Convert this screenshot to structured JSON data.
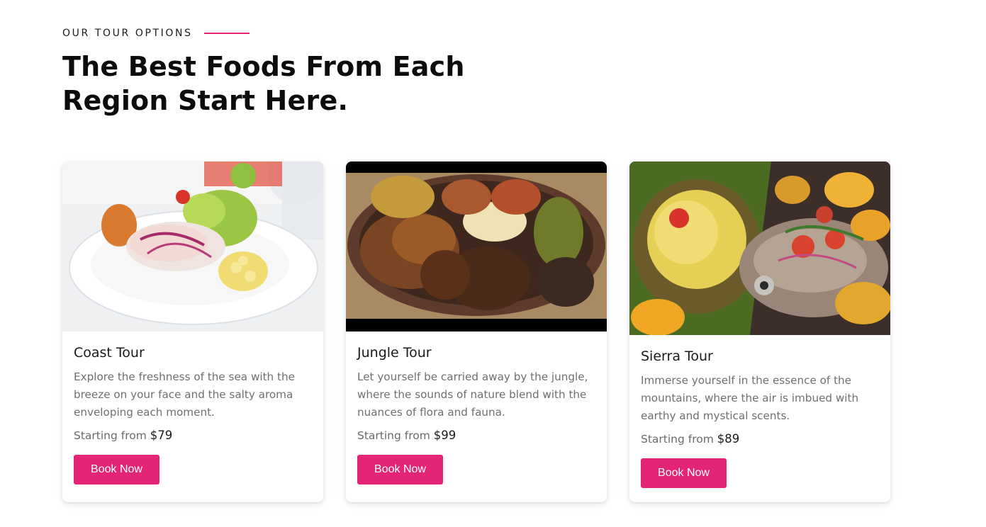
{
  "section": {
    "eyebrow": "OUR TOUR OPTIONS",
    "headline_line1": "The Best Foods From Each",
    "headline_line2": "Region Start Here.",
    "accent_color": "#e0246f"
  },
  "tours": [
    {
      "title": "Coast Tour",
      "description": "Explore the freshness of the sea with the breeze on your face and the salty aroma enveloping each moment.",
      "price_label": "Starting from",
      "price": "$79",
      "button_label": "Book Now",
      "image": "ceviche-plate-photo"
    },
    {
      "title": "Jungle Tour",
      "description": "Let yourself be carried away by the jungle, where the sounds of nature blend with the nuances of flora and fauna.",
      "price_label": "Starting from",
      "price": "$99",
      "button_label": "Book Now",
      "image": "grilled-meats-bowl-photo"
    },
    {
      "title": "Sierra Tour",
      "description": "Immerse yourself in the essence of the mountains, where the air is imbued with earthy and mystical scents.",
      "price_label": "Starting from",
      "price": "$89",
      "button_label": "Book Now",
      "image": "leaf-wrapped-fish-photo"
    }
  ],
  "colors": {
    "button": "#e42575",
    "text_muted": "#6f6f6f"
  }
}
